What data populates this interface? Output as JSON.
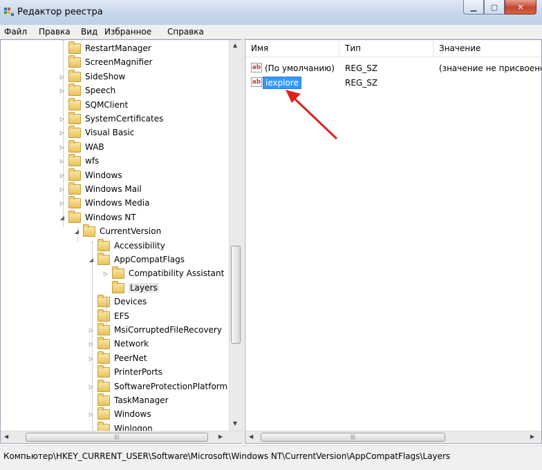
{
  "window": {
    "title": "Редактор реестра"
  },
  "menu": [
    "Файл",
    "Правка",
    "Вид",
    "Избранное",
    "Справка"
  ],
  "tree": {
    "items": [
      {
        "label": "RestartManager",
        "expander": ""
      },
      {
        "label": "ScreenMagnifier",
        "expander": ""
      },
      {
        "label": "SideShow",
        "expander": "▷"
      },
      {
        "label": "Speech",
        "expander": "▷"
      },
      {
        "label": "SQMClient",
        "expander": ""
      },
      {
        "label": "SystemCertificates",
        "expander": "▷"
      },
      {
        "label": "Visual Basic",
        "expander": "▷"
      },
      {
        "label": "WAB",
        "expander": "▷"
      },
      {
        "label": "wfs",
        "expander": "▷"
      },
      {
        "label": "Windows",
        "expander": "▷"
      },
      {
        "label": "Windows Mail",
        "expander": "▷"
      },
      {
        "label": "Windows Media",
        "expander": "▷"
      },
      {
        "label": "Windows NT",
        "expander": "◢"
      },
      {
        "label": "CurrentVersion",
        "expander": "◢"
      },
      {
        "label": "Accessibility",
        "expander": ""
      },
      {
        "label": "AppCompatFlags",
        "expander": "◢"
      },
      {
        "label": "Compatibility Assistant",
        "expander": "▷"
      },
      {
        "label": "Layers",
        "expander": "",
        "selected": true
      },
      {
        "label": "Devices",
        "expander": ""
      },
      {
        "label": "EFS",
        "expander": ""
      },
      {
        "label": "MsiCorruptedFileRecovery",
        "expander": "▷"
      },
      {
        "label": "Network",
        "expander": "▷"
      },
      {
        "label": "PeerNet",
        "expander": "▷"
      },
      {
        "label": "PrinterPorts",
        "expander": ""
      },
      {
        "label": "SoftwareProtectionPlatform",
        "expander": "▷"
      },
      {
        "label": "TaskManager",
        "expander": ""
      },
      {
        "label": "Windows",
        "expander": "▷"
      },
      {
        "label": "Winlogon",
        "expander": ""
      }
    ]
  },
  "list": {
    "columns": {
      "name": "Имя",
      "type": "Тип",
      "value": "Значение"
    },
    "rows": [
      {
        "name": "(По умолчанию)",
        "type": "REG_SZ",
        "value": "(значение не присвоено)",
        "icon": "string-value-icon"
      },
      {
        "name": "iexplore",
        "type": "REG_SZ",
        "value": "",
        "icon": "string-value-icon",
        "selected": true
      }
    ]
  },
  "annotation": {
    "color": "#e0201b",
    "icon": "red-arrow-pointer"
  },
  "statusbar": {
    "path": "Компьютер\\HKEY_CURRENT_USER\\Software\\Microsoft\\Windows NT\\CurrentVersion\\AppCompatFlags\\Layers"
  },
  "colors": {
    "selection": "#3399ff",
    "titlebar": "#cad9ec"
  }
}
